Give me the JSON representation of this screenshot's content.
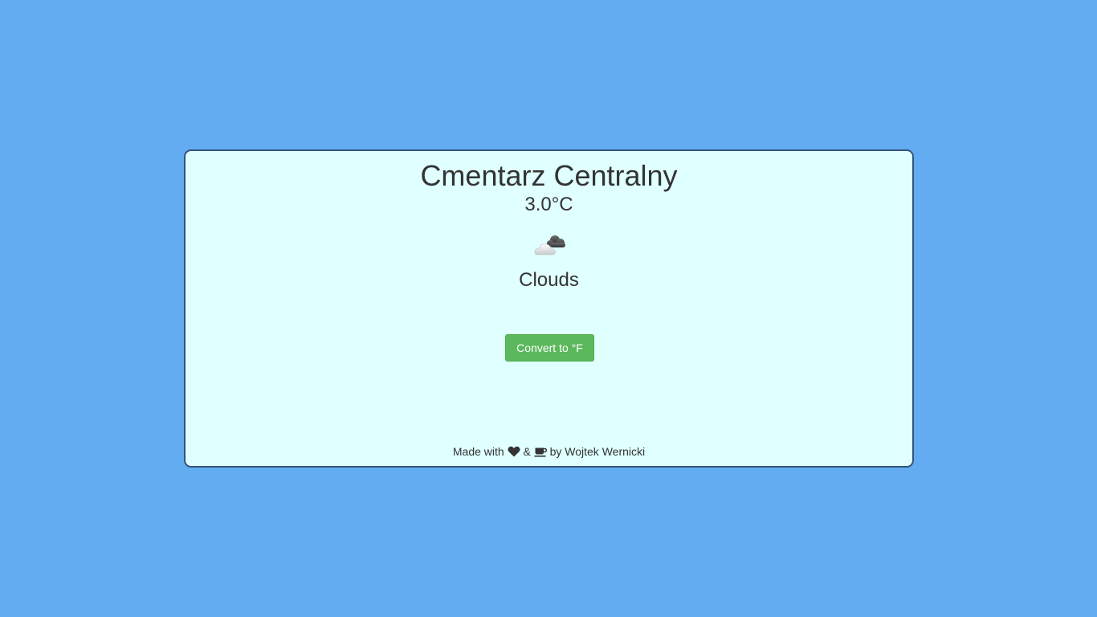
{
  "location": {
    "name": "Cmentarz Centralny"
  },
  "weather": {
    "temperature": "3.0°C",
    "icon": "cloud-icon",
    "condition": "Clouds"
  },
  "actions": {
    "convert_label": "Convert to °F"
  },
  "footer": {
    "made_with": "Made with",
    "heart_icon": "heart-icon",
    "and": "&",
    "coffee_icon": "coffee-icon",
    "by_author": "by Wojtek Wernicki"
  },
  "colors": {
    "background": "#63acf2",
    "card": "#e0ffff",
    "card_border": "#34557a",
    "button": "#5cb85c",
    "text": "#333333"
  }
}
